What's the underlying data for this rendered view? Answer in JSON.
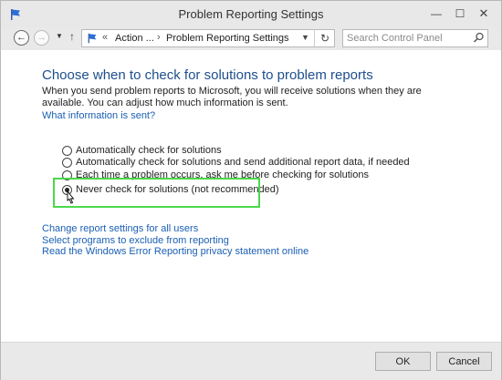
{
  "window": {
    "title": "Problem Reporting Settings",
    "controls": {
      "minimize": "—",
      "maximize": "☐",
      "close": "✕"
    }
  },
  "nav": {
    "back_icon": "back-arrow-icon",
    "forward_icon": "forward-arrow-icon",
    "breadcrumb": [
      "Action ...",
      "Problem Reporting Settings"
    ],
    "search_placeholder": "Search Control Panel"
  },
  "main": {
    "heading": "Choose when to check for solutions to problem reports",
    "description": "When you send problem reports to Microsoft, you will receive solutions when they are available. You can adjust how much information is sent.",
    "info_link": "What information is sent?",
    "options": [
      {
        "label": "Automatically check for solutions",
        "selected": false
      },
      {
        "label": "Automatically check for solutions and send additional report data, if needed",
        "selected": false
      },
      {
        "label": "Each time a problem occurs, ask me before checking for solutions",
        "selected": false
      },
      {
        "label": "Never check for solutions (not recommended)",
        "selected": true
      }
    ],
    "links": [
      "Change report settings for all users",
      "Select programs to exclude from reporting",
      "Read the Windows Error Reporting privacy statement online"
    ]
  },
  "footer": {
    "ok_label": "OK",
    "cancel_label": "Cancel"
  },
  "colors": {
    "heading": "#1e4e8c",
    "link": "#1a5fb4",
    "highlight": "#4bd84b"
  }
}
